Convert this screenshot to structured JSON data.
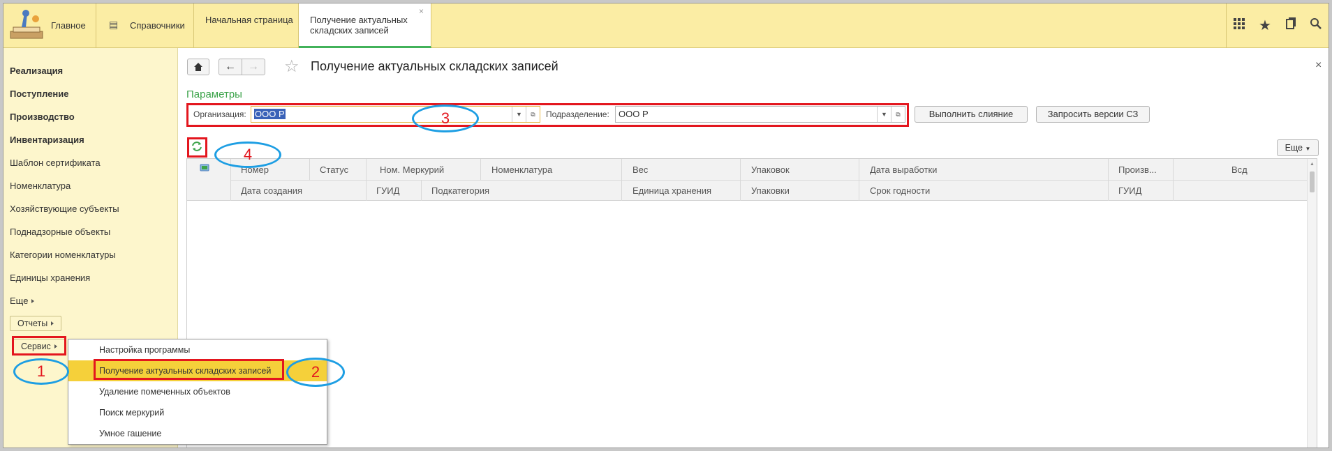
{
  "topbar": {
    "home_label": "Главное",
    "refs_label": "Справочники",
    "tab_start": "Начальная страница",
    "tab_active": "Получение актуальных складских записей",
    "icons": [
      "apps-grid-icon",
      "star-icon",
      "history-icon",
      "search-icon"
    ]
  },
  "sidebar": {
    "items": [
      {
        "label": "Реализация",
        "bold": true
      },
      {
        "label": "Поступление",
        "bold": true
      },
      {
        "label": "Производство",
        "bold": true
      },
      {
        "label": "Инвентаризация",
        "bold": true
      },
      {
        "label": "Шаблон сертификата"
      },
      {
        "label": "Номенклатура"
      },
      {
        "label": "Хозяйствующие субъекты"
      },
      {
        "label": "Поднадзорные объекты"
      },
      {
        "label": "Категории номенклатуры"
      },
      {
        "label": "Единицы хранения"
      },
      {
        "label": "Еще"
      }
    ],
    "reports_button": "Отчеты",
    "service_button": "Сервис"
  },
  "popup_menu": {
    "items": [
      "Настройка программы",
      "Получение актуальных складских записей",
      "Удаление помеченных объектов",
      "Поиск меркурий",
      "Умное гашение"
    ],
    "highlighted_index": 1
  },
  "main": {
    "title": "Получение актуальных складских записей",
    "params_label": "Параметры",
    "org_label": "Организация:",
    "org_value": "ООО Р",
    "division_label": "Подразделение:",
    "division_value": "ООО Р",
    "merge_button": "Выполнить слияние",
    "request_button": "Запросить версии СЗ",
    "more_button": "Еще",
    "close_glyph": "×"
  },
  "grid": {
    "row1": [
      "Номер",
      "Статус",
      "Ном. Меркурий",
      "Номенклатура",
      "Вес",
      "Упаковок",
      "Дата выработки",
      "Произв...",
      "Всд"
    ],
    "row2": [
      "Дата создания",
      "ГУИД",
      "Подкатегория",
      "Единица хранения",
      "Упаковки",
      "Срок годности",
      "ГУИД"
    ]
  },
  "annotations": [
    "1",
    "2",
    "3",
    "4"
  ],
  "colors": {
    "topbar_bg": "#fbeda4",
    "sidebar_bg": "#fdf6cc",
    "accent_green": "#42b25a",
    "highlight": "#f5d03a",
    "annotation_red": "#e3161e",
    "annotation_blue": "#1d9ee3"
  }
}
